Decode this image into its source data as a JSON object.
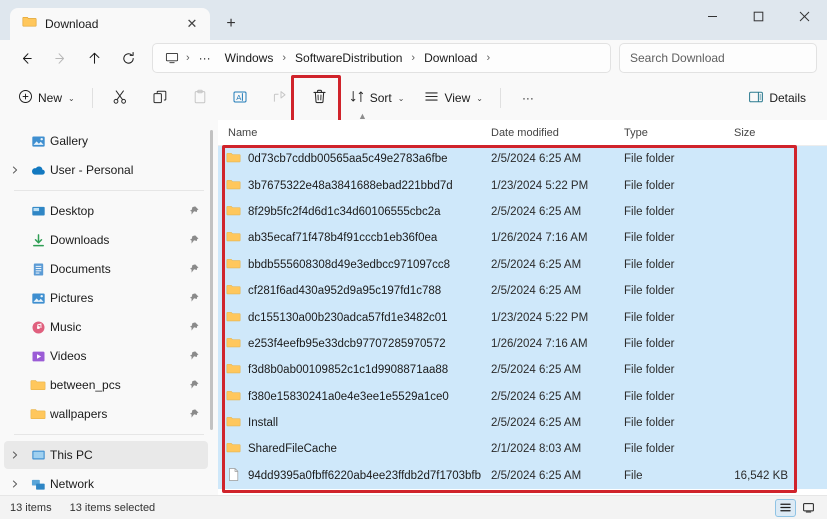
{
  "window": {
    "tab_title": "Download",
    "tab_close_label": "✕",
    "new_tab_label": "+",
    "minimize_label": "—",
    "maximize_label": "▢",
    "close_label": "✕"
  },
  "address": {
    "back_label": "←",
    "forward_label": "→",
    "up_label": "↑",
    "refresh_label": "⟳",
    "overflow_label": "···",
    "separator": "›",
    "crumbs": [
      {
        "label": "Windows"
      },
      {
        "label": "SoftwareDistribution"
      },
      {
        "label": "Download"
      }
    ],
    "search_placeholder": "Search Download"
  },
  "toolbar": {
    "new_label": "New",
    "cut_label": "Cut",
    "copy_label": "Copy",
    "paste_label": "Paste",
    "rename_label": "Rename",
    "share_label": "Share",
    "delete_label": "Delete",
    "sort_label": "Sort",
    "view_label": "View",
    "more_label": "···",
    "details_label": "Details",
    "chevron": "⌄",
    "highlight_color": "#d0232b"
  },
  "sidebar": {
    "items": [
      {
        "label": "Gallery",
        "icon": "gallery-icon",
        "expandable": false,
        "pinned": false,
        "selected": false
      },
      {
        "label": "User - Personal",
        "icon": "onedrive-icon",
        "expandable": true,
        "pinned": false,
        "selected": false
      },
      {
        "separator": true
      },
      {
        "label": "Desktop",
        "icon": "desktop-icon",
        "expandable": false,
        "pinned": true,
        "selected": false
      },
      {
        "label": "Downloads",
        "icon": "downloads-icon",
        "expandable": false,
        "pinned": true,
        "selected": false
      },
      {
        "label": "Documents",
        "icon": "documents-icon",
        "expandable": false,
        "pinned": true,
        "selected": false
      },
      {
        "label": "Pictures",
        "icon": "pictures-icon",
        "expandable": false,
        "pinned": true,
        "selected": false
      },
      {
        "label": "Music",
        "icon": "music-icon",
        "expandable": false,
        "pinned": true,
        "selected": false
      },
      {
        "label": "Videos",
        "icon": "videos-icon",
        "expandable": false,
        "pinned": true,
        "selected": false
      },
      {
        "label": "between_pcs",
        "icon": "folder-icon",
        "expandable": false,
        "pinned": true,
        "selected": false
      },
      {
        "label": "wallpapers",
        "icon": "folder-icon",
        "expandable": false,
        "pinned": true,
        "selected": false
      },
      {
        "separator": true
      },
      {
        "label": "This PC",
        "icon": "this-pc-icon",
        "expandable": true,
        "pinned": false,
        "selected": true
      },
      {
        "label": "Network",
        "icon": "network-icon",
        "expandable": true,
        "pinned": false,
        "selected": false
      }
    ]
  },
  "filelist": {
    "sort_indicator": "▲",
    "columns": [
      {
        "key": "name",
        "label": "Name"
      },
      {
        "key": "date",
        "label": "Date modified"
      },
      {
        "key": "type",
        "label": "Type"
      },
      {
        "key": "size",
        "label": "Size"
      }
    ],
    "rows": [
      {
        "name": "0d73cb7cddb00565aa5c49e2783a6fbe",
        "date": "2/5/2024 6:25 AM",
        "type": "File folder",
        "size": "",
        "icon": "folder-icon",
        "selected": true
      },
      {
        "name": "3b7675322e48a3841688ebad221bbd7d",
        "date": "1/23/2024 5:22 PM",
        "type": "File folder",
        "size": "",
        "icon": "folder-icon",
        "selected": true
      },
      {
        "name": "8f29b5fc2f4d6d1c34d60106555cbc2a",
        "date": "2/5/2024 6:25 AM",
        "type": "File folder",
        "size": "",
        "icon": "folder-icon",
        "selected": true
      },
      {
        "name": "ab35ecaf71f478b4f91cccb1eb36f0ea",
        "date": "1/26/2024 7:16 AM",
        "type": "File folder",
        "size": "",
        "icon": "folder-icon",
        "selected": true
      },
      {
        "name": "bbdb555608308d49e3edbcc971097cc8",
        "date": "2/5/2024 6:25 AM",
        "type": "File folder",
        "size": "",
        "icon": "folder-icon",
        "selected": true
      },
      {
        "name": "cf281f6ad430a952d9a95c197fd1c788",
        "date": "2/5/2024 6:25 AM",
        "type": "File folder",
        "size": "",
        "icon": "folder-icon",
        "selected": true
      },
      {
        "name": "dc155130a00b230adca57fd1e3482c01",
        "date": "1/23/2024 5:22 PM",
        "type": "File folder",
        "size": "",
        "icon": "folder-icon",
        "selected": true
      },
      {
        "name": "e253f4eefb95e33dcb97707285970572",
        "date": "1/26/2024 7:16 AM",
        "type": "File folder",
        "size": "",
        "icon": "folder-icon",
        "selected": true
      },
      {
        "name": "f3d8b0ab00109852c1c1d9908871aa88",
        "date": "2/5/2024 6:25 AM",
        "type": "File folder",
        "size": "",
        "icon": "folder-icon",
        "selected": true
      },
      {
        "name": "f380e15830241a0e4e3ee1e5529a1ce0",
        "date": "2/5/2024 6:25 AM",
        "type": "File folder",
        "size": "",
        "icon": "folder-icon",
        "selected": true
      },
      {
        "name": "Install",
        "date": "2/5/2024 6:25 AM",
        "type": "File folder",
        "size": "",
        "icon": "folder-icon",
        "selected": true
      },
      {
        "name": "SharedFileCache",
        "date": "2/1/2024 8:03 AM",
        "type": "File folder",
        "size": "",
        "icon": "folder-icon",
        "selected": true
      },
      {
        "name": "94dd9395a0fbff6220ab4ee23ffdb2d7f1703bfb",
        "date": "2/5/2024 6:25 AM",
        "type": "File",
        "size": "16,542 KB",
        "icon": "file-icon",
        "selected": true
      }
    ]
  },
  "status": {
    "item_count": "13 items",
    "selected_count": "13 items selected",
    "details_view_label": "Details view",
    "icons_view_label": "Large icons view"
  }
}
